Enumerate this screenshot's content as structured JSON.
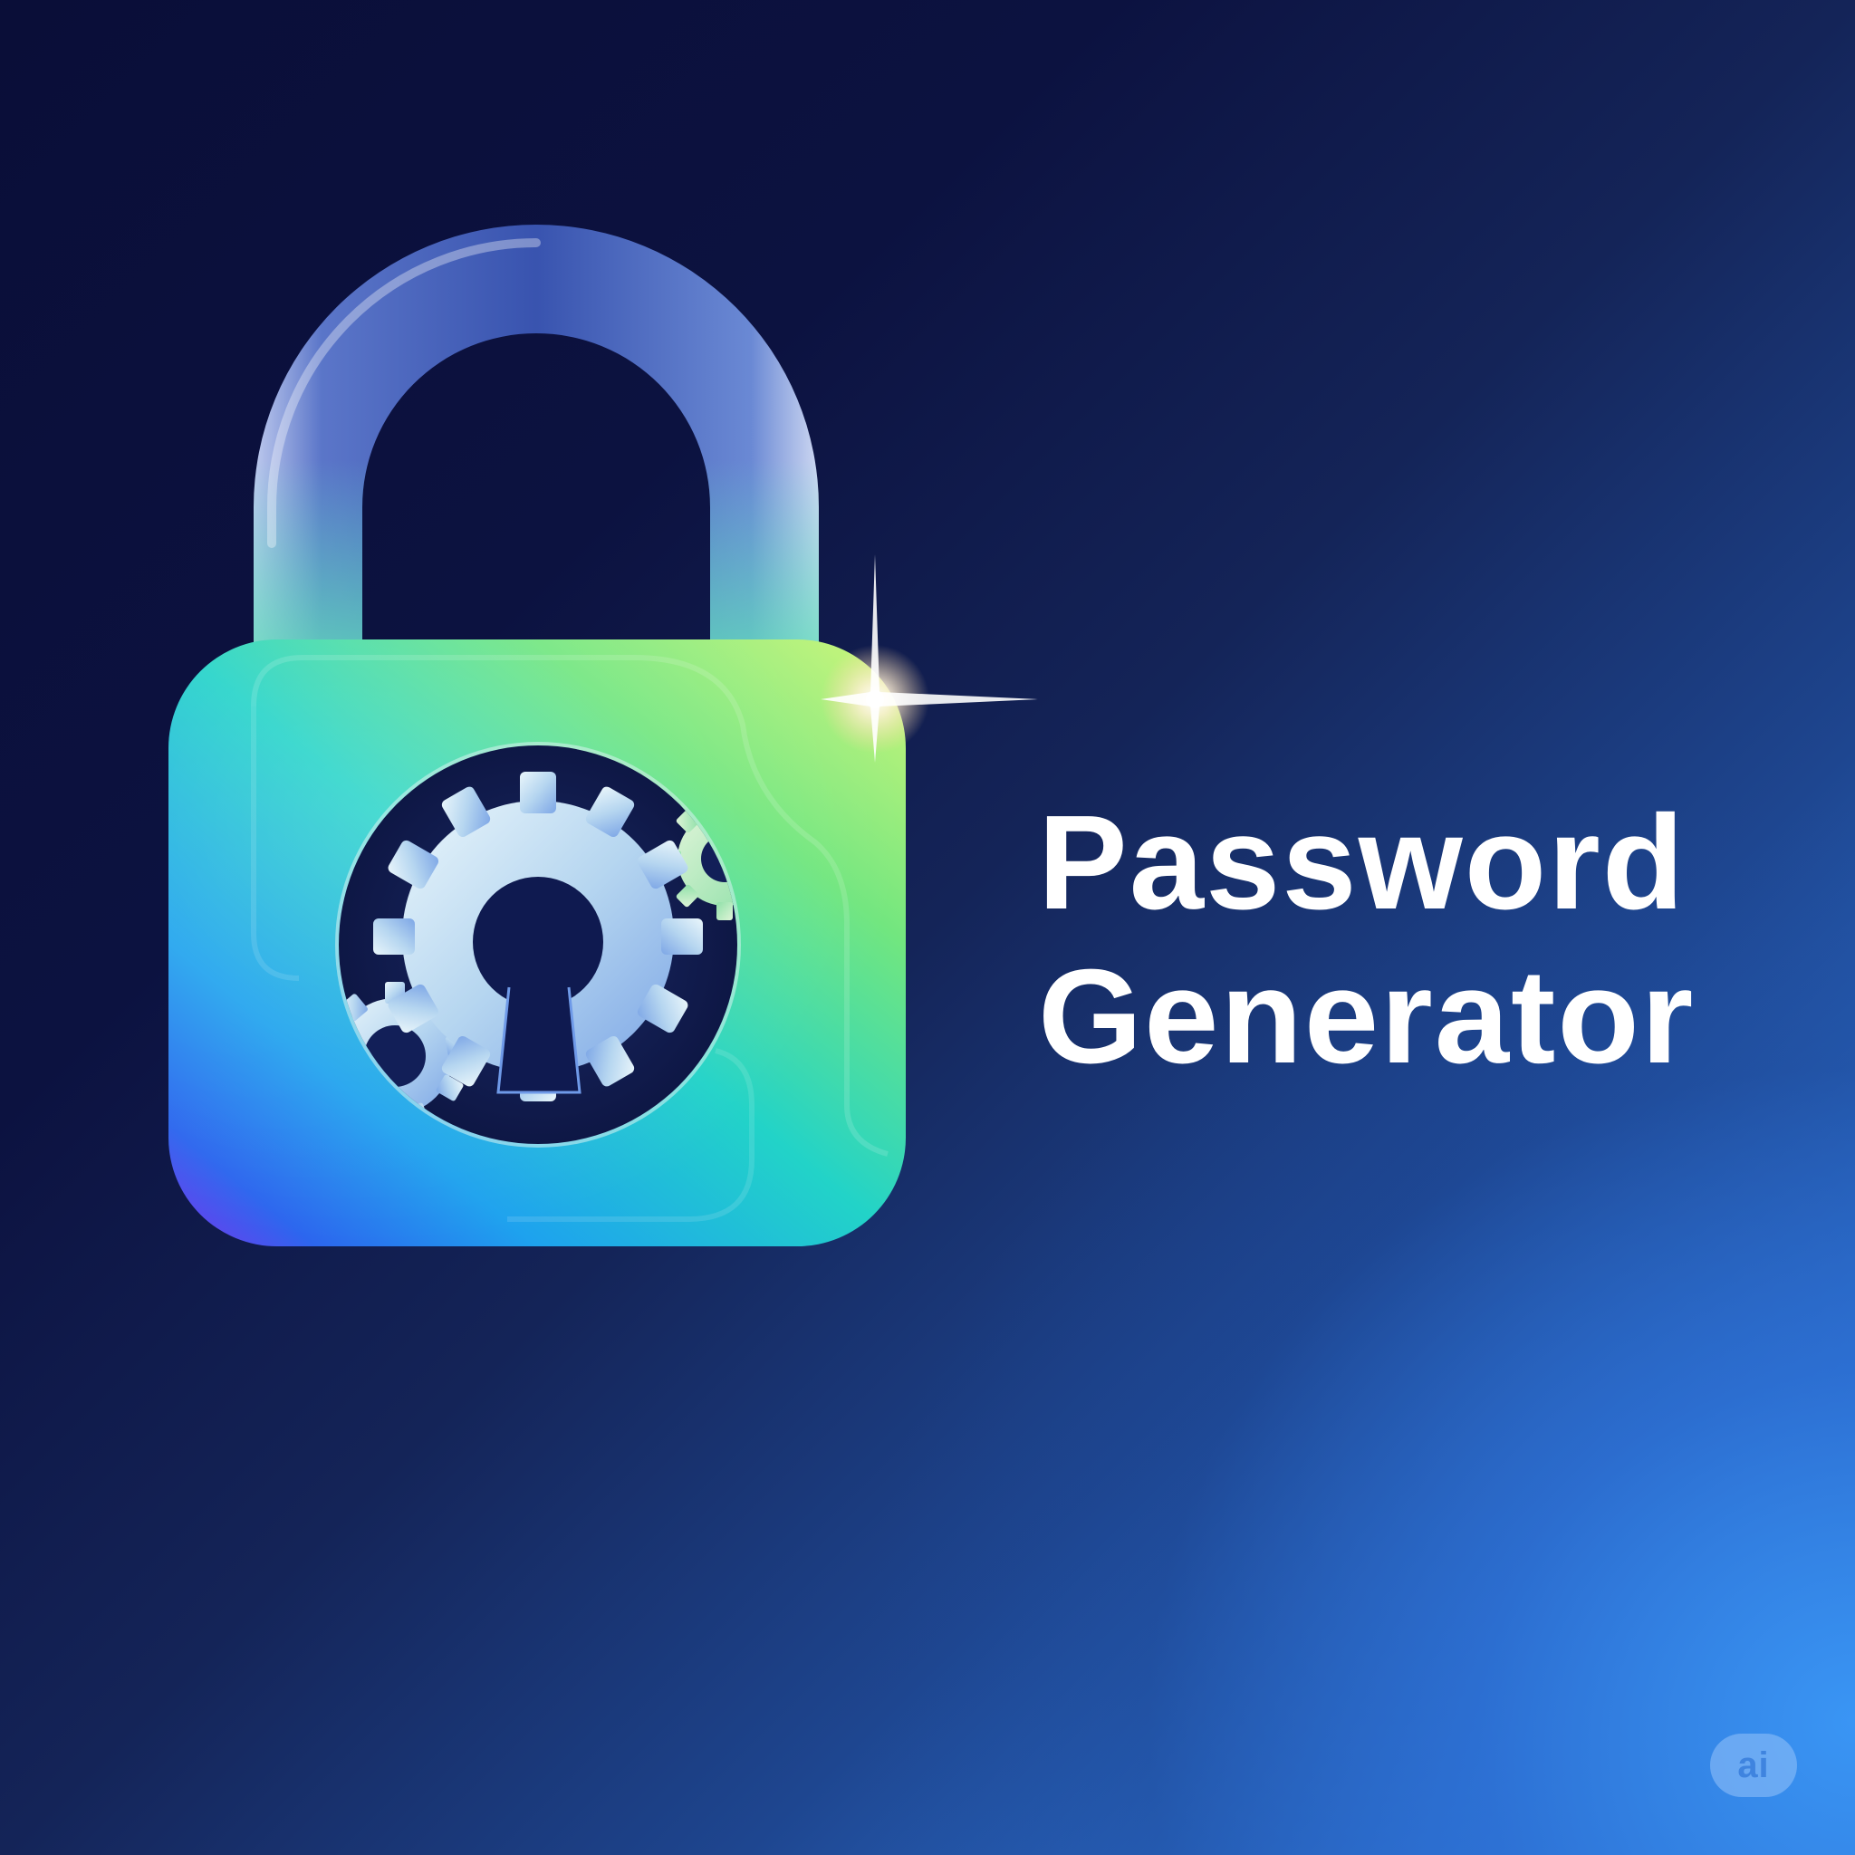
{
  "title": {
    "line1": "Password",
    "line2": "Generator"
  },
  "badge": {
    "label": "ai"
  },
  "icons": {
    "main": "padlock-icon",
    "keyhole": "keyhole-icon",
    "gears": "gear-icon",
    "sparkle": "sparkle-icon"
  },
  "colors": {
    "background_dark": "#0b0f3a",
    "background_light": "#3891f2",
    "lock_body_top_right": "#c8f57a",
    "lock_body_mid": "#2edcc8",
    "lock_body_bottom_left": "#7a3af0",
    "shackle": "#a8b8f0",
    "text": "#ffffff"
  }
}
